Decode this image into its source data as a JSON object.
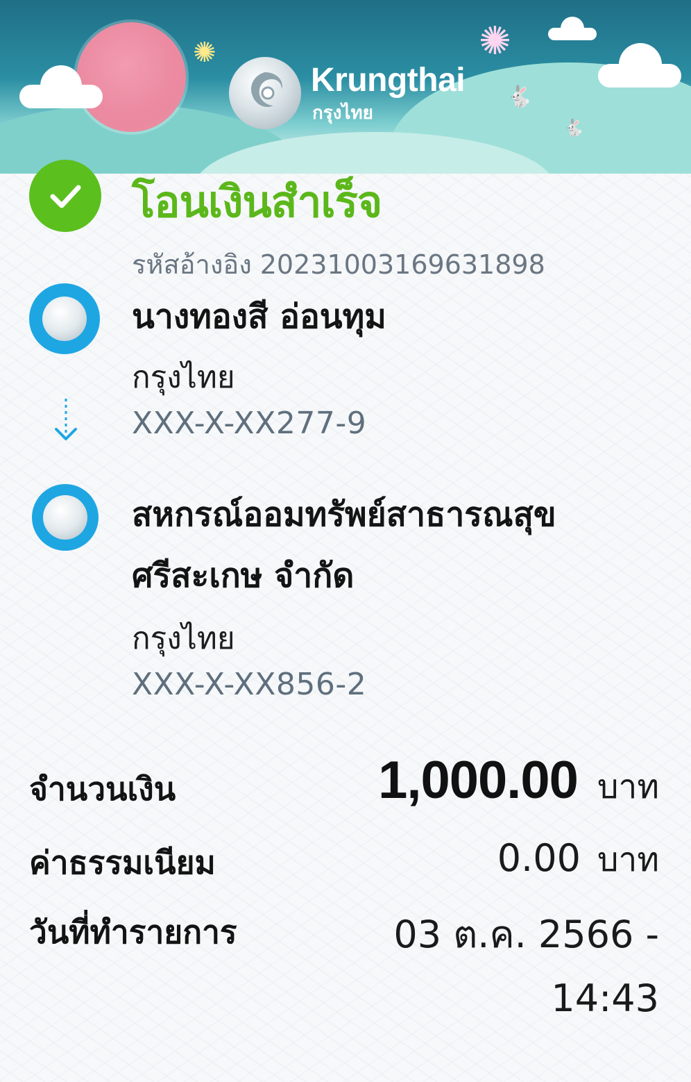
{
  "header": {
    "brand_en": "Krungthai",
    "brand_th": "กรุงไทย"
  },
  "status": {
    "title": "โอนเงินสำเร็จ",
    "ref_label": "รหัสอ้างอิง",
    "ref_value": "20231003169631898"
  },
  "sender": {
    "name": "นางทองสี อ่อนทุม",
    "bank": "กรุงไทย",
    "account": "XXX-X-XX277-9"
  },
  "receiver": {
    "name": "สหกรณ์ออมทรัพย์สาธารณสุขศรีสะเกษ จำกัด",
    "bank": "กรุงไทย",
    "account": "XXX-X-XX856-2"
  },
  "details": {
    "amount_label": "จำนวนเงิน",
    "amount_value": "1,000.00",
    "amount_unit": "บาท",
    "fee_label": "ค่าธรรมเนียม",
    "fee_value": "0.00",
    "fee_unit": "บาท",
    "date_label": "วันที่ทำรายการ",
    "date_value": "03 ต.ค. 2566 - 14:43"
  },
  "colors": {
    "success_green": "#5bb71a",
    "bank_blue": "#1ea6e3",
    "header_teal": "#1f6f86"
  }
}
